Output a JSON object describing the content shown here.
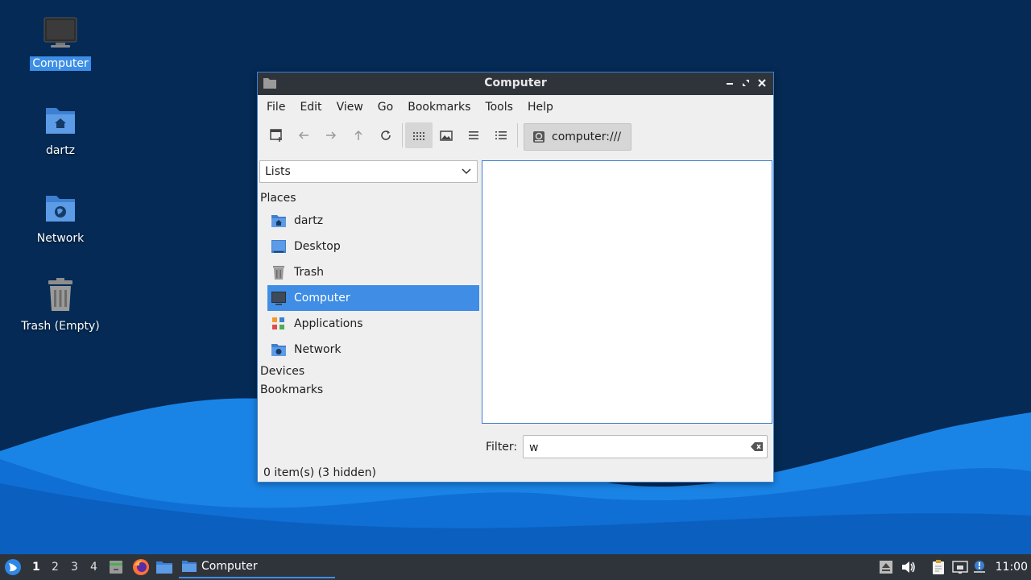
{
  "desktop": {
    "icons": [
      {
        "label": "Computer",
        "icon": "computer-icon"
      },
      {
        "label": "dartz",
        "icon": "home-folder-icon"
      },
      {
        "label": "Network",
        "icon": "network-folder-icon"
      },
      {
        "label": "Trash (Empty)",
        "icon": "trash-icon"
      }
    ]
  },
  "window": {
    "title": "Computer",
    "menu": [
      "File",
      "Edit",
      "View",
      "Go",
      "Bookmarks",
      "Tools",
      "Help"
    ],
    "location": "computer:///",
    "side_pane_mode": "Lists",
    "sidebar": {
      "places_header": "Places",
      "places": [
        "dartz",
        "Desktop",
        "Trash",
        "Computer",
        "Applications",
        "Network"
      ],
      "devices_header": "Devices",
      "bookmarks_header": "Bookmarks"
    },
    "filter": {
      "label": "Filter:",
      "value": "w"
    },
    "status": "0 item(s) (3 hidden)"
  },
  "taskbar": {
    "workspaces": [
      "1",
      "2",
      "3",
      "4"
    ],
    "task_label": "Computer",
    "clock": "11:00"
  },
  "colors": {
    "accent": "#3f8de5",
    "titlebar": "#2f343b",
    "desktop": "#042a55"
  }
}
